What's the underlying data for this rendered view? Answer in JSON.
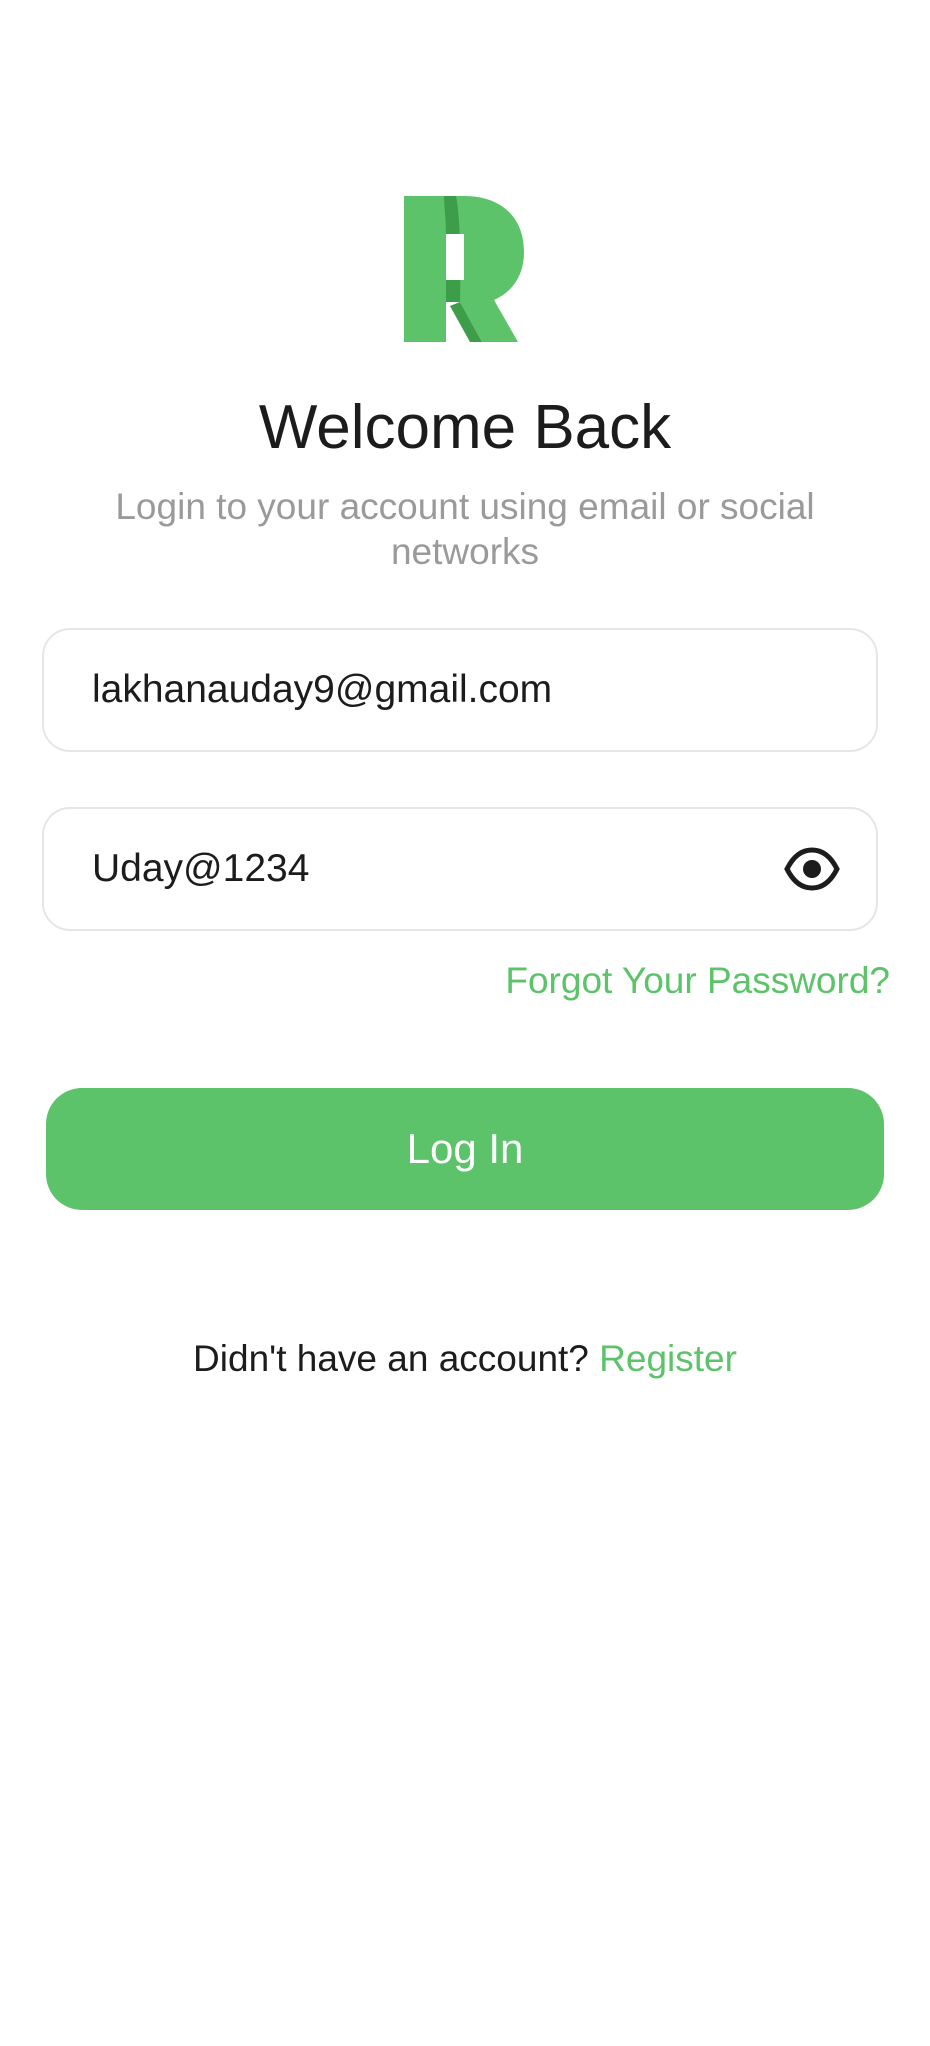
{
  "brand": {
    "logo_letter": "R",
    "accent_color": "#5cc36a",
    "accent_dark": "#3e9d4b"
  },
  "header": {
    "title": "Welcome Back",
    "subtitle": "Login to your account using email or social networks"
  },
  "form": {
    "email_value": "lakhanauday9@gmail.com",
    "password_value": "Uday@1234",
    "visibility_icon": "eye-icon",
    "forgot_label": "Forgot Your Password?",
    "login_label": "Log In"
  },
  "footer": {
    "prompt": "Didn't have an account?",
    "register_label": "Register"
  }
}
